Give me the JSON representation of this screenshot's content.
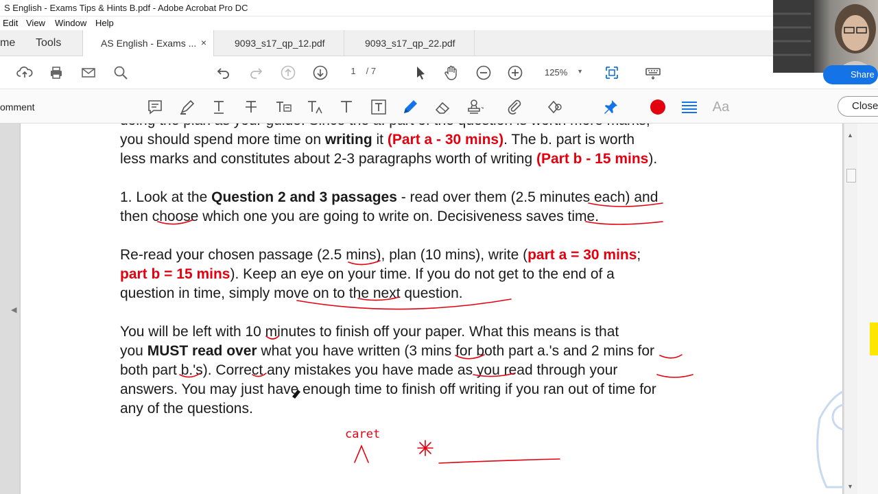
{
  "window": {
    "title": "S English - Exams Tips & Hints B.pdf - Adobe Acrobat Pro DC"
  },
  "menu": {
    "items": [
      "Edit",
      "View",
      "Window",
      "Help"
    ]
  },
  "tabs": {
    "home": "me",
    "tools": "Tools",
    "documents": [
      {
        "label": "AS English - Exams ...",
        "active": true,
        "close": "×"
      },
      {
        "label": "9093_s17_qp_12.pdf",
        "active": false
      },
      {
        "label": "9093_s17_qp_22.pdf",
        "active": false
      }
    ]
  },
  "toolbar": {
    "page_current": "1",
    "page_total": "/ 7",
    "zoom": "125%",
    "share_label": "Share"
  },
  "comment_bar": {
    "label": "omment",
    "font_label": "Aa",
    "close_label": "Close",
    "accent_red": "#e3000f",
    "accent_blue": "#1473e6"
  },
  "document": {
    "para0": {
      "l1": "doing the plan as your guide. Since the a. part of the question is worth more marks,",
      "l2a": "you should spend more time on ",
      "l2b": "writing",
      "l2c": " it ",
      "l2d": "(Part a - 30 mins)",
      "l2e": ". The b. part is worth",
      "l3a": "less marks and constitutes about 2-3 paragraphs worth of writing ",
      "l3b": "(Part b - 15 mins",
      "l3c": ")."
    },
    "para1": {
      "l1a": "1. Look at the ",
      "l1b": "Question 2 and 3 passages",
      "l1c": " - read over them (2.5 minutes each) and",
      "l2": "then choose which one you are going to write on. Decisiveness saves time."
    },
    "para2": {
      "l1a": "Re-read your chosen passage (2.5 mins), plan (10 mins), write (",
      "l1b": "part a = 30 mins",
      "l1c": ";",
      "l2a": "part b = 15 mins",
      "l2b": "). Keep an eye on your time. If you do not get to the end of a",
      "l3": "question in time, simply move on to the next question."
    },
    "para3": {
      "l1": "You will be left with 10 minutes to finish off your paper. What this means is that",
      "l2a": "you ",
      "l2b": "MUST read over",
      "l2c": " what you have written (3 mins for both part a.'s and 2 mins for",
      "l3": "both part b.'s). Correct any mistakes you have made as you read through your",
      "l4": "answers. You may just have enough time to finish off writing if you ran out of time for",
      "l5": "any of the questions."
    },
    "handwriting": {
      "caret_label": "caret"
    }
  }
}
